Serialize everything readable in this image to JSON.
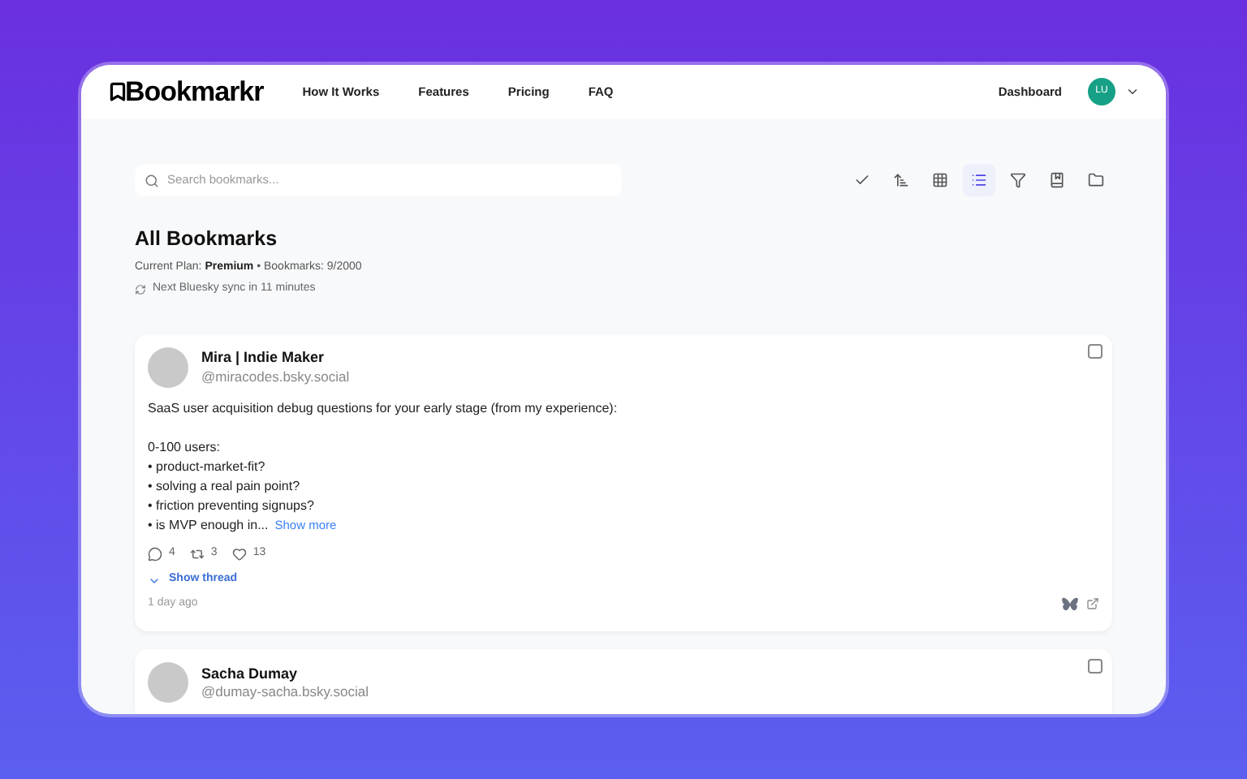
{
  "brand": "Bookmarkr",
  "nav": [
    "How It Works",
    "Features",
    "Pricing",
    "FAQ"
  ],
  "header": {
    "dashboard": "Dashboard",
    "avatar_initials": "LU"
  },
  "search": {
    "placeholder": "Search bookmarks..."
  },
  "toolbar": [
    {
      "kind": "check",
      "selected": false
    },
    {
      "kind": "sort",
      "selected": false
    },
    {
      "kind": "grid",
      "selected": false
    },
    {
      "kind": "list",
      "selected": true
    },
    {
      "kind": "filter",
      "selected": false
    },
    {
      "kind": "bookmark",
      "selected": false
    },
    {
      "kind": "folder",
      "selected": false
    }
  ],
  "page": {
    "title": "All Bookmarks",
    "plan_label": "Current Plan: ",
    "plan": "Premium",
    "bookmarks": " • Bookmarks: 9/2000",
    "sync": "Next Bluesky sync in 11 minutes"
  },
  "posts": [
    {
      "name": "Mira | Indie Maker",
      "handle": "@miracodes.bsky.social",
      "checked": false,
      "intro": "SaaS user acquisition debug questions for your early stage (from my experience):",
      "lines": [
        "0-100 users:",
        "• product-market-fit?",
        "• solving a real pain point?",
        "• friction preventing signups?",
        "• is MVP enough in..."
      ],
      "show_more": "Show more",
      "replies": "4",
      "reposts": "3",
      "likes": "13",
      "thread": "Show thread",
      "time": "1 day ago"
    },
    {
      "name": "Sacha Dumay",
      "handle": "@dumay-sacha.bsky.social",
      "checked": false
    }
  ]
}
